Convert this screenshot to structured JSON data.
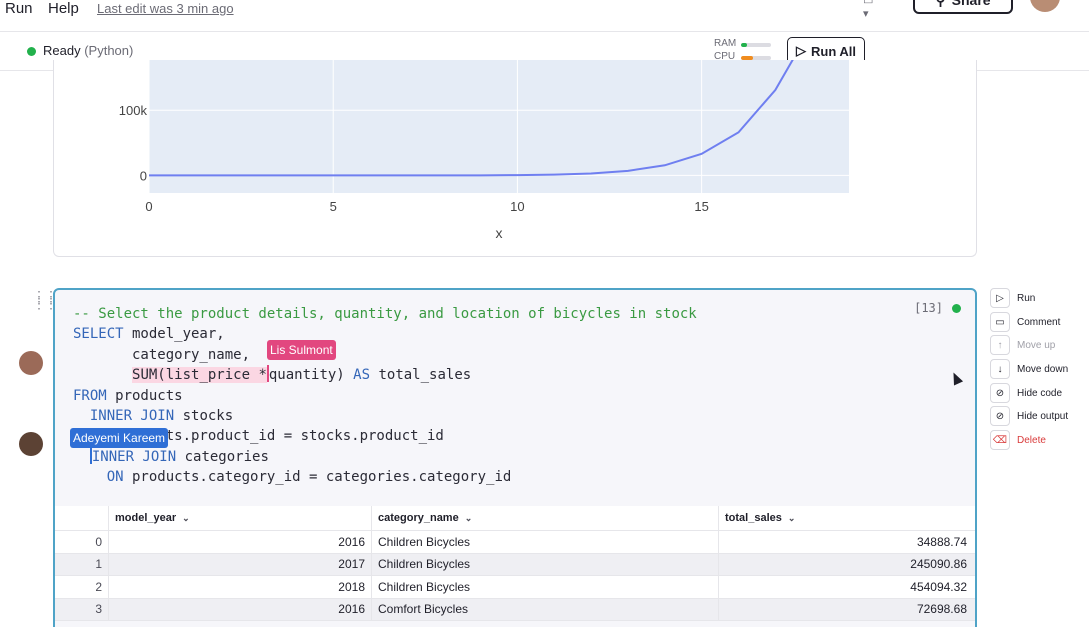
{
  "menubar": {
    "items": [
      "Run",
      "Help"
    ],
    "last_edit": "Last edit was 3 min ago",
    "share_label": "Share"
  },
  "status": {
    "state": "Ready",
    "language": "(Python)",
    "ram_label": "RAM",
    "cpu_label": "CPU",
    "ram_usage": 0.2,
    "cpu_usage": 0.4,
    "run_all_label": "Run All",
    "colors": {
      "ready": "#22b14c",
      "ram": "#22b14c",
      "cpu": "#f08c1e"
    }
  },
  "chart_data": {
    "type": "line",
    "xlabel": "x",
    "ylabel": "",
    "xlim": [
      0,
      19
    ],
    "x_ticks": [
      0,
      5,
      10,
      15
    ],
    "x_tick_labels": [
      "0",
      "5",
      "10",
      "15"
    ],
    "y_ticks": [
      0,
      100000
    ],
    "y_tick_labels": [
      "0",
      "100k"
    ],
    "visible_ylim": [
      -27000,
      177000
    ],
    "grid": true,
    "series": [
      {
        "color": "#6f7ff0",
        "x": [
          0,
          1,
          2,
          3,
          4,
          5,
          6,
          7,
          8,
          9,
          10,
          11,
          12,
          13,
          14,
          15,
          16,
          17,
          17.5
        ],
        "y": [
          0,
          0,
          0,
          0,
          0,
          0,
          0,
          0,
          0,
          100,
          400,
          1200,
          3000,
          7000,
          15500,
          33000,
          66000,
          131000,
          180000
        ]
      }
    ]
  },
  "cell": {
    "exec_count": "[13]",
    "code_lines": [
      [
        {
          "t": "-- Select the product details, quantity, and location of bicycles in stock",
          "c": "cm"
        }
      ],
      [
        {
          "t": "SELECT",
          "c": "kw"
        },
        {
          "t": " model_year,",
          "c": ""
        }
      ],
      [
        {
          "t": "       category_name, ",
          "c": ""
        }
      ],
      [
        {
          "t": "       ",
          "c": ""
        },
        {
          "t": "SUM(list_price *",
          "c": "hl"
        },
        {
          "t": "|",
          "c": "cursor-pink"
        },
        {
          "t": "quantity) ",
          "c": ""
        },
        {
          "t": "AS",
          "c": "kw"
        },
        {
          "t": " total_sales",
          "c": ""
        }
      ],
      [
        {
          "t": "FROM",
          "c": "kw"
        },
        {
          "t": " products",
          "c": ""
        }
      ],
      [
        {
          "t": "  ",
          "c": ""
        },
        {
          "t": "INNER JOIN",
          "c": "kw"
        },
        {
          "t": " stocks",
          "c": ""
        }
      ],
      [
        {
          "t": "           ts.product_id = stocks.product_id",
          "c": ""
        }
      ],
      [
        {
          "t": "  ",
          "c": ""
        },
        {
          "t": "|",
          "c": "cursor-blue"
        },
        {
          "t": "INNER JOIN",
          "c": "kw"
        },
        {
          "t": " categories",
          "c": ""
        }
      ],
      [
        {
          "t": "    ",
          "c": ""
        },
        {
          "t": "ON",
          "c": "kw"
        },
        {
          "t": " products.category_id = categories.category_id",
          "c": ""
        }
      ]
    ],
    "collaborators": [
      {
        "name": "Lis Sulmont",
        "color": "#e2477f"
      },
      {
        "name": "Adeyemi Kareem",
        "color": "#2f6fd6"
      }
    ]
  },
  "table": {
    "columns": [
      "model_year",
      "category_name",
      "total_sales"
    ],
    "rows": [
      {
        "idx": "0",
        "model_year": "2016",
        "category_name": "Children Bicycles",
        "total_sales": "34888.74"
      },
      {
        "idx": "1",
        "model_year": "2017",
        "category_name": "Children Bicycles",
        "total_sales": "245090.86"
      },
      {
        "idx": "2",
        "model_year": "2018",
        "category_name": "Children Bicycles",
        "total_sales": "454094.32"
      },
      {
        "idx": "3",
        "model_year": "2016",
        "category_name": "Comfort Bicycles",
        "total_sales": "72698.68"
      }
    ]
  },
  "actions": [
    {
      "label": "Run",
      "icon": "play-icon",
      "state": "normal"
    },
    {
      "label": "Comment",
      "icon": "comment-icon",
      "state": "normal"
    },
    {
      "label": "Move up",
      "icon": "arrow-up-icon",
      "state": "disabled"
    },
    {
      "label": "Move down",
      "icon": "arrow-down-icon",
      "state": "normal"
    },
    {
      "label": "Hide code",
      "icon": "eye-off-icon",
      "state": "normal"
    },
    {
      "label": "Hide output",
      "icon": "eye-off-icon",
      "state": "normal"
    },
    {
      "label": "Delete",
      "icon": "trash-icon",
      "state": "danger"
    }
  ]
}
